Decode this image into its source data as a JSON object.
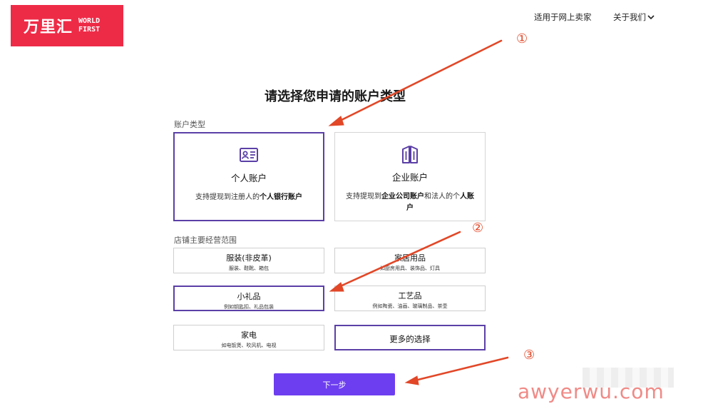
{
  "header": {
    "logo_cn": "万里汇",
    "logo_en_line1": "WORLD",
    "logo_en_line2": "FIRST",
    "nav_sellers": "适用于网上卖家",
    "nav_about": "关于我们"
  },
  "page": {
    "title": "请选择您申请的账户类型"
  },
  "account_type": {
    "label": "账户类型",
    "personal": {
      "name": "个人账户",
      "desc_prefix": "支持提现到注册人的",
      "desc_bold": "个人银行账户",
      "selected": true
    },
    "business": {
      "name": "企业账户",
      "desc_prefix": "支持提现到",
      "desc_bold1": "企业公司账户",
      "desc_mid": "和法人的个",
      "desc_bold2": "人账户",
      "selected": false
    }
  },
  "store_scope": {
    "label": "店铺主要经营范围",
    "categories": [
      {
        "title": "服装(非皮革)",
        "sub": "服装、鞋靴、箱包"
      },
      {
        "title": "家居用品",
        "sub": "如厨房用具、装饰品、灯具"
      },
      {
        "title": "小礼品",
        "sub": "例如钥匙扣、礼品包装"
      },
      {
        "title": "工艺品",
        "sub": "例如陶瓷、油画、玻璃制品、茶壶"
      },
      {
        "title": "家电",
        "sub": "如电饭煲、吹风机、电视"
      },
      {
        "title": "更多的选择",
        "sub": ""
      }
    ],
    "selected_index": 2
  },
  "next_button": "下一步",
  "annotations": {
    "step1": "①",
    "step2": "②",
    "step3": "③",
    "arrow_color": "#e24727"
  },
  "watermark": "awyerwu.com",
  "colors": {
    "brand_red": "#ee2b47",
    "accent_purple": "#5b3fa6",
    "button_purple": "#6d3ef0"
  }
}
